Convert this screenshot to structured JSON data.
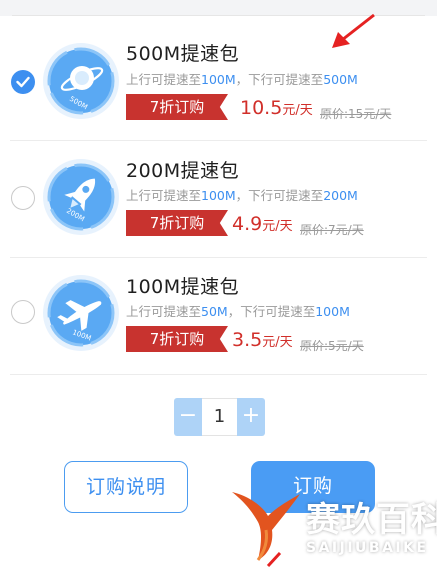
{
  "packages": [
    {
      "title": "500M提速包",
      "desc_pre": "上行可提速至",
      "up": "100M",
      "desc_mid": "，下行可提速至",
      "down": "500M",
      "tag": "7折订购",
      "price": "10.5",
      "price_unit": "元/天",
      "orig": "原价:15元/天",
      "badge_text": "500M",
      "selected": true
    },
    {
      "title": "200M提速包",
      "desc_pre": "上行可提速至",
      "up": "100M",
      "desc_mid": "，下行可提速至",
      "down": "200M",
      "tag": "7折订购",
      "price": "4.9",
      "price_unit": "元/天",
      "orig": "原价:7元/天",
      "badge_text": "200M",
      "selected": false
    },
    {
      "title": "100M提速包",
      "desc_pre": "上行可提速至",
      "up": "50M",
      "desc_mid": "，下行可提速至",
      "down": "100M",
      "tag": "7折订购",
      "price": "3.5",
      "price_unit": "元/天",
      "orig": "原价:5元/天",
      "badge_text": "100M",
      "selected": false
    }
  ],
  "stepper": {
    "minus": "−",
    "value": "1",
    "plus": "+"
  },
  "buttons": {
    "description": "订购说明",
    "order": "订购"
  },
  "watermark": {
    "name": "赛玖百科",
    "sub": "SAIJIUBAIKE"
  },
  "colors": {
    "accent": "#3d8ff0",
    "tag_red": "#c8332f",
    "price_red": "#d12f2a"
  },
  "icons": [
    "check-icon",
    "planet-badge-icon",
    "rocket-badge-icon",
    "airplane-badge-icon",
    "whale-tail-logo",
    "red-arrow-annotation"
  ]
}
